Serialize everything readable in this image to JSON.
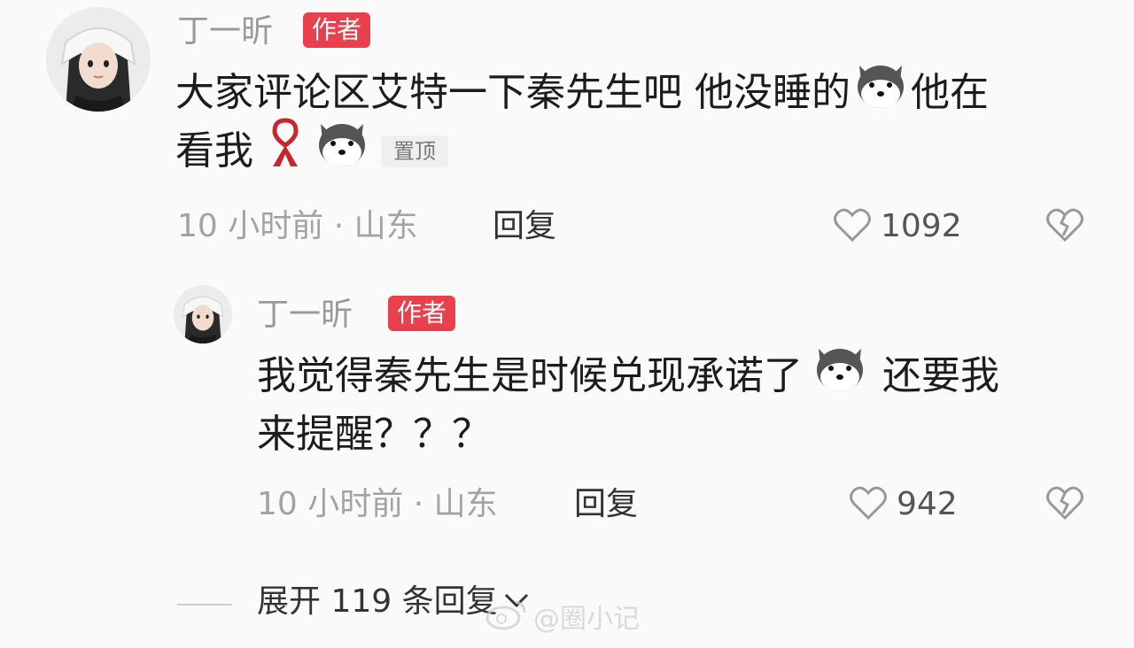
{
  "comment": {
    "author": "丁一昕",
    "badge": "作者",
    "line1": "大家评论区艾特一下秦先生吧 他没睡的",
    "line1_tail": "他在",
    "line2": "看我",
    "pin_label": "置顶",
    "time_location": "10 小时前 · 山东",
    "reply_label": "回复",
    "likes": "1092"
  },
  "reply": {
    "author": "丁一昕",
    "badge": "作者",
    "line1": "我觉得秦先生是时候兑现承诺了",
    "line1_tail": "还要我",
    "line2": "来提醒？？？",
    "time_location": "10 小时前 · 山东",
    "reply_label": "回复",
    "likes": "942"
  },
  "expand": {
    "label": "展开 119 条回复"
  },
  "watermark": "@圈小记",
  "colors": {
    "badge": "#e8414d",
    "muted": "#9a9a9a",
    "background": "#fafafa"
  },
  "icons": [
    "avatar",
    "husky-emoji-icon",
    "red-ribbon-icon",
    "heart-icon",
    "broken-heart-icon",
    "chevron-down-icon",
    "weibo-icon"
  ]
}
